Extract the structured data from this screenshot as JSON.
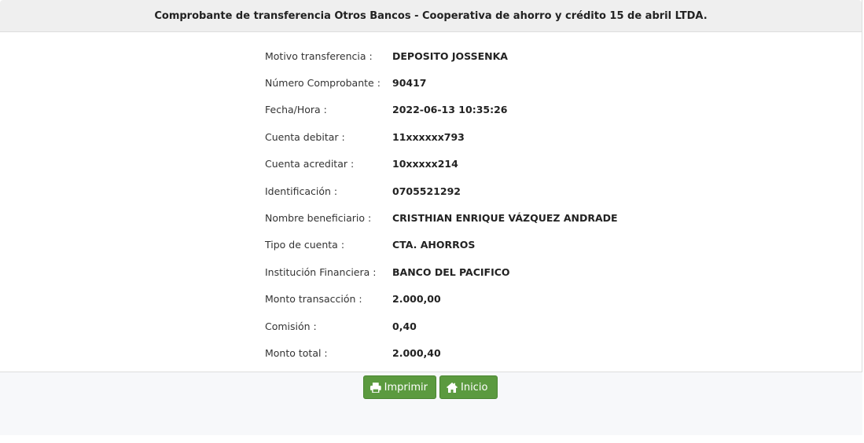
{
  "header": {
    "title": "Comprobante de transferencia Otros Bancos - Cooperativa de ahorro y crédito 15 de abril LTDA."
  },
  "details": [
    {
      "label": "Motivo transferencia :",
      "value": "DEPOSITO JOSSENKA"
    },
    {
      "label": "Número Comprobante :",
      "value": "90417"
    },
    {
      "label": "Fecha/Hora :",
      "value": "2022-06-13 10:35:26"
    },
    {
      "label": "Cuenta debitar :",
      "value": "11xxxxxx793"
    },
    {
      "label": "Cuenta acreditar :",
      "value": "10xxxxx214"
    },
    {
      "label": "Identificación :",
      "value": "0705521292"
    },
    {
      "label": "Nombre beneficiario :",
      "value": "CRISTHIAN ENRIQUE VÁZQUEZ ANDRADE"
    },
    {
      "label": "Tipo de cuenta :",
      "value": "CTA. AHORROS"
    },
    {
      "label": "Institución Financiera :",
      "value": "BANCO DEL PACIFICO"
    },
    {
      "label": "Monto transacción :",
      "value": "2.000,00"
    },
    {
      "label": "Comisión :",
      "value": "0,40"
    },
    {
      "label": "Monto total :",
      "value": "2.000,40"
    }
  ],
  "actions": {
    "print_label": "Imprimir",
    "print_icon": "printer-icon",
    "home_label": "Inicio",
    "home_icon": "home-icon"
  },
  "colors": {
    "button_bg": "#5b9a3f",
    "header_bg": "#efefef"
  }
}
